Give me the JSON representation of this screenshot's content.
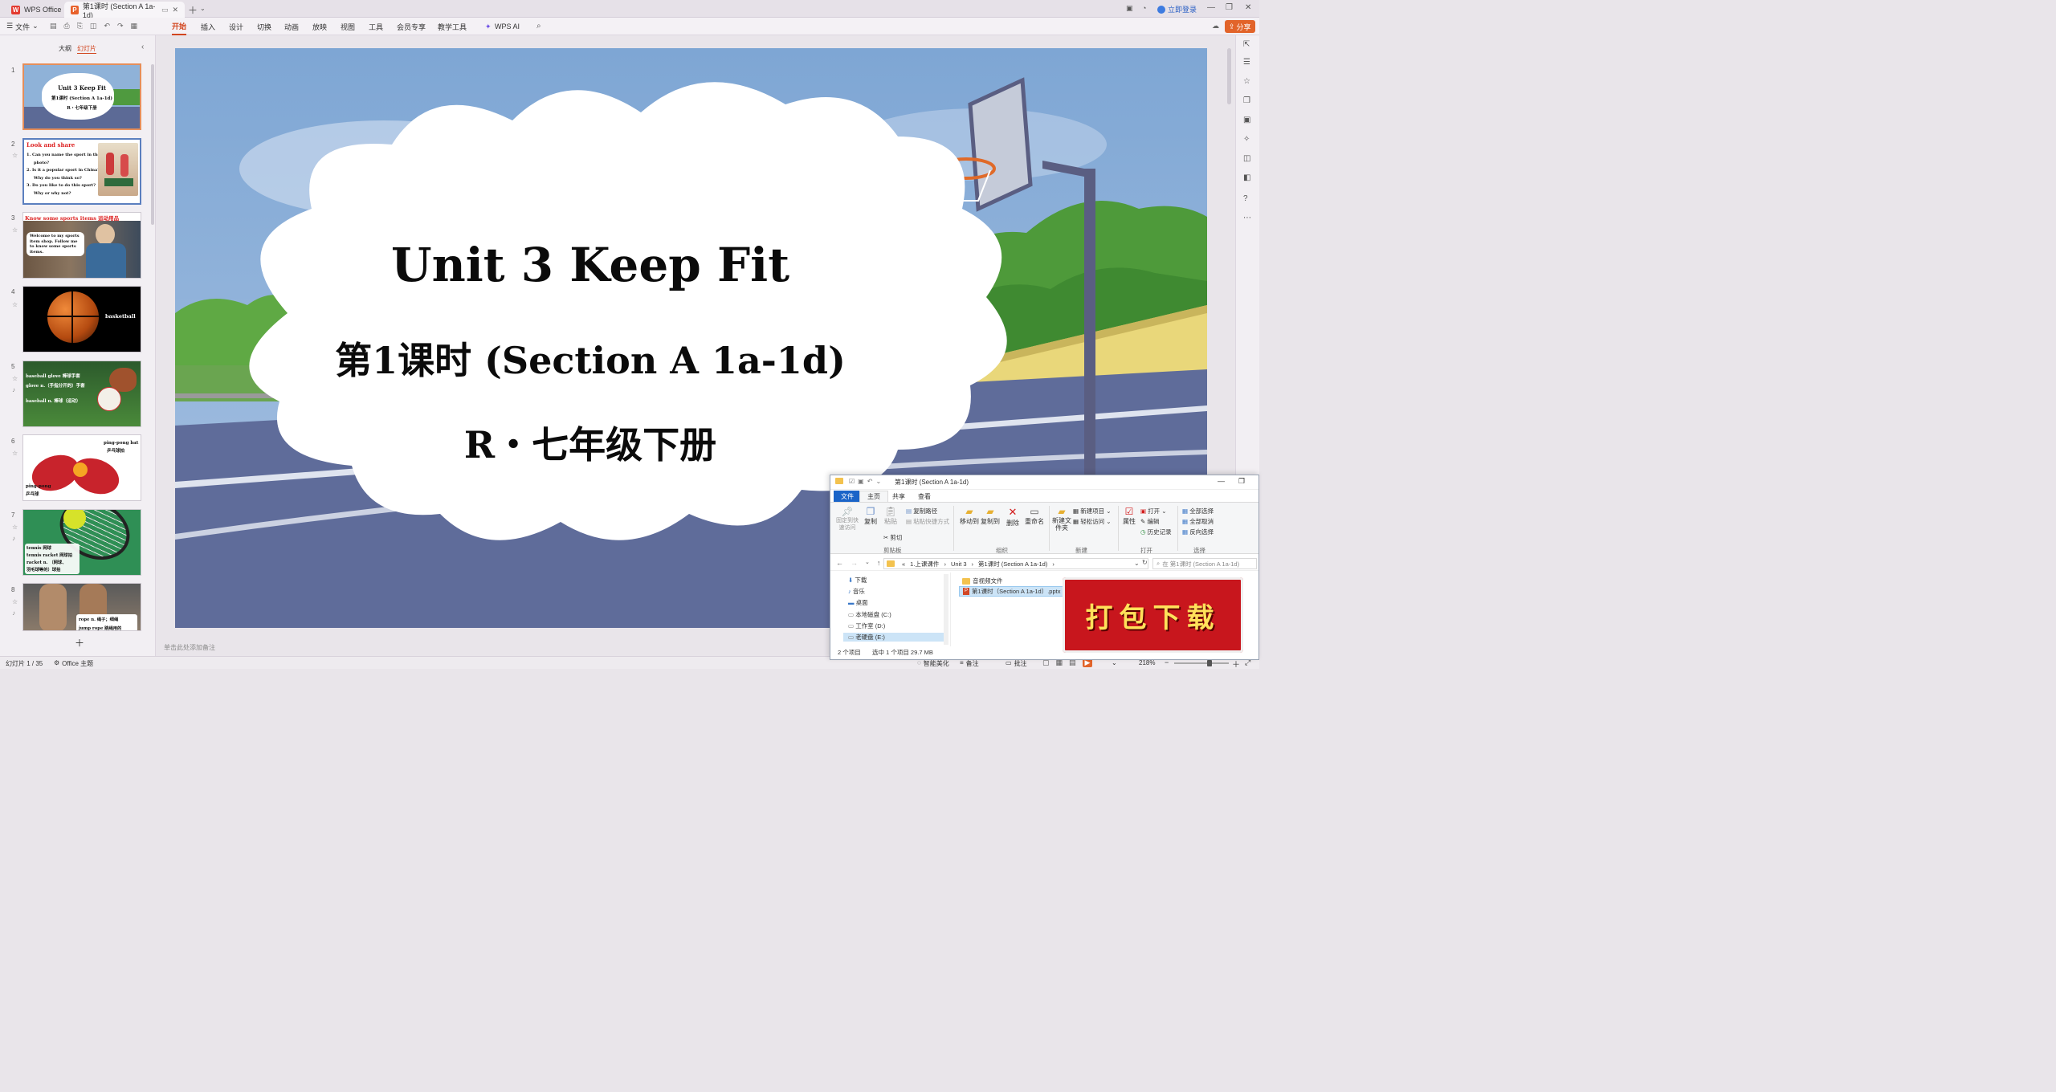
{
  "titlebar": {
    "app_name": "WPS Office",
    "doc_tab": "第1课时 (Section A 1a-1d)",
    "login": "立即登录"
  },
  "ribbon": {
    "file_menu": "文件",
    "tabs": [
      "开始",
      "插入",
      "设计",
      "切换",
      "动画",
      "放映",
      "视图",
      "工具",
      "会员专享",
      "教学工具",
      "WPS AI"
    ],
    "share": "分享"
  },
  "panel": {
    "tab_outline": "大纲",
    "tab_slides": "幻灯片",
    "numbers": [
      "1",
      "2",
      "3",
      "4",
      "5",
      "6",
      "7",
      "8"
    ],
    "t1": {
      "l1": "Unit 3 Keep Fit",
      "l2": "第1课时 (Section A 1a-1d)",
      "l3": "R・七年级下册"
    },
    "t2": {
      "head": "Look and share",
      "q1": "1.  Can you name the sport in the",
      "q1b": "photo?",
      "q2": "2.  Is it a popular sport in China?",
      "q2b": "Why do you think so?",
      "q3": "3.  Do you like to do this sport?",
      "q3b": "Why or why not?"
    },
    "t3": {
      "head": "Know some sports items 运动用品",
      "bubble": "Welcome to my sports item shop. Follow me to know some sports items."
    },
    "t4": {
      "label": "basketball"
    },
    "t5": {
      "l1": "baseball glove 棒球手套",
      "l2": "glove n.（手指分开的）手套",
      "l3": "baseball n. 棒球（运动）"
    },
    "t6": {
      "bat": "ping-pong bat",
      "bat_cn": "乒乓球拍",
      "pp": "ping-pong",
      "pp_cn": "乒乓球"
    },
    "t7": {
      "l1": "tennis 网球",
      "l2": "tennis racket 网球拍",
      "l3": "racket n. （网球、",
      "l4": "羽毛球等的）球拍"
    },
    "t8": {
      "l1": "rope n. 绳子；细绳",
      "l2": "jump rope 跳绳用的"
    }
  },
  "slide": {
    "title": "Unit 3 Keep Fit",
    "subtitle": "第1课时 (Section A 1a-1d)",
    "grade": "R・七年级下册"
  },
  "notes_placeholder": "单击此处添加备注",
  "status": {
    "slide_count": "幻灯片 1 / 35",
    "theme": "Office 主题",
    "beautify": "智能美化",
    "notes": "备注",
    "comments": "批注",
    "zoom": "218%"
  },
  "explorer": {
    "title": "第1课时 (Section A 1a-1d)",
    "tabs": [
      "文件",
      "主页",
      "共享",
      "查看"
    ],
    "pin": "固定到快速访问",
    "copy": "复制",
    "paste": "粘贴",
    "copy_path": "复制路径",
    "paste_shortcut": "粘贴快捷方式",
    "cut": "剪切",
    "move_to": "移动到",
    "copy_to": "复制到",
    "delete": "删除",
    "rename": "重命名",
    "new_folder": "新建文件夹",
    "new_item": "新建项目",
    "easy_access": "轻松访问",
    "properties": "属性",
    "open": "打开",
    "edit": "编辑",
    "history": "历史记录",
    "select_all": "全部选择",
    "select_none": "全部取消",
    "invert": "反向选择",
    "g_clipboard": "剪贴板",
    "g_organize": "组织",
    "g_new": "新建",
    "g_open": "打开",
    "g_select": "选择",
    "path": [
      "1.上课课件",
      "Unit 3",
      "第1课时 (Section A 1a-1d)"
    ],
    "search_placeholder": "在 第1课时 (Section A 1a-1d)",
    "nav": [
      "下载",
      "音乐",
      "桌面",
      "本地磁盘 (C:)",
      "工作室 (D:)",
      "老硬盘 (E:)"
    ],
    "files": [
      "音视频文件",
      "第1课时（Section A 1a-1d）.pptx"
    ],
    "status_items": "2 个项目",
    "status_selected": "选中 1 个项目  29.7 MB"
  },
  "stamp": "打包下载"
}
